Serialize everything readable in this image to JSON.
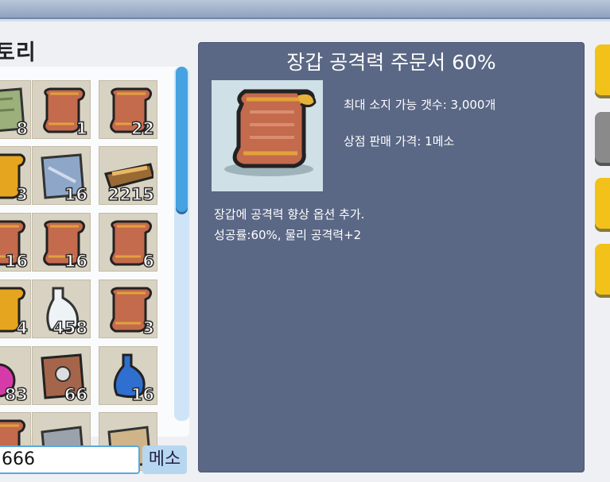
{
  "inventory": {
    "title": "토리",
    "slots": [
      {
        "icon": "map-icon",
        "qty": "8"
      },
      {
        "icon": "scroll-icon",
        "qty": "1"
      },
      {
        "icon": "scroll-icon",
        "qty": "22"
      },
      {
        "icon": "gold-scroll-icon",
        "qty": "3"
      },
      {
        "icon": "blue-map-icon",
        "qty": "16"
      },
      {
        "icon": "bread-tray-icon",
        "qty": "2215"
      },
      {
        "icon": "scroll-icon",
        "qty": "16"
      },
      {
        "icon": "scroll-icon",
        "qty": "16"
      },
      {
        "icon": "scroll-icon",
        "qty": "6"
      },
      {
        "icon": "gold-scroll-icon",
        "qty": "4"
      },
      {
        "icon": "bottle-icon",
        "qty": "458"
      },
      {
        "icon": "scroll-icon",
        "qty": "3"
      },
      {
        "icon": "pink-potion-icon",
        "qty": "83"
      },
      {
        "icon": "skull-scroll-icon",
        "qty": "66"
      },
      {
        "icon": "blue-potion-icon",
        "qty": "16"
      },
      {
        "icon": "scroll-icon",
        "qty": ""
      },
      {
        "icon": "grey-scroll-icon",
        "qty": ""
      },
      {
        "icon": "tan-scroll-icon",
        "qty": ""
      }
    ]
  },
  "meso": {
    "value": "666",
    "label": "메소"
  },
  "item_info": {
    "title": "장갑 공격력 주문서 60%",
    "max_stack": "최대 소지 가능 갯수: 3,000개",
    "sell_price": "상점 판매 가격: 1메소",
    "description_line1": "장갑에 공격력 향상 옵션 추가.",
    "description_line2": "성공률:60%, 물리 공격력+2"
  },
  "colors": {
    "info_panel": "#5a6785",
    "scrollbar_thumb": "#46a2e0",
    "side_button_yellow": "#f2c21b",
    "side_button_grey": "#8a8a8a"
  }
}
